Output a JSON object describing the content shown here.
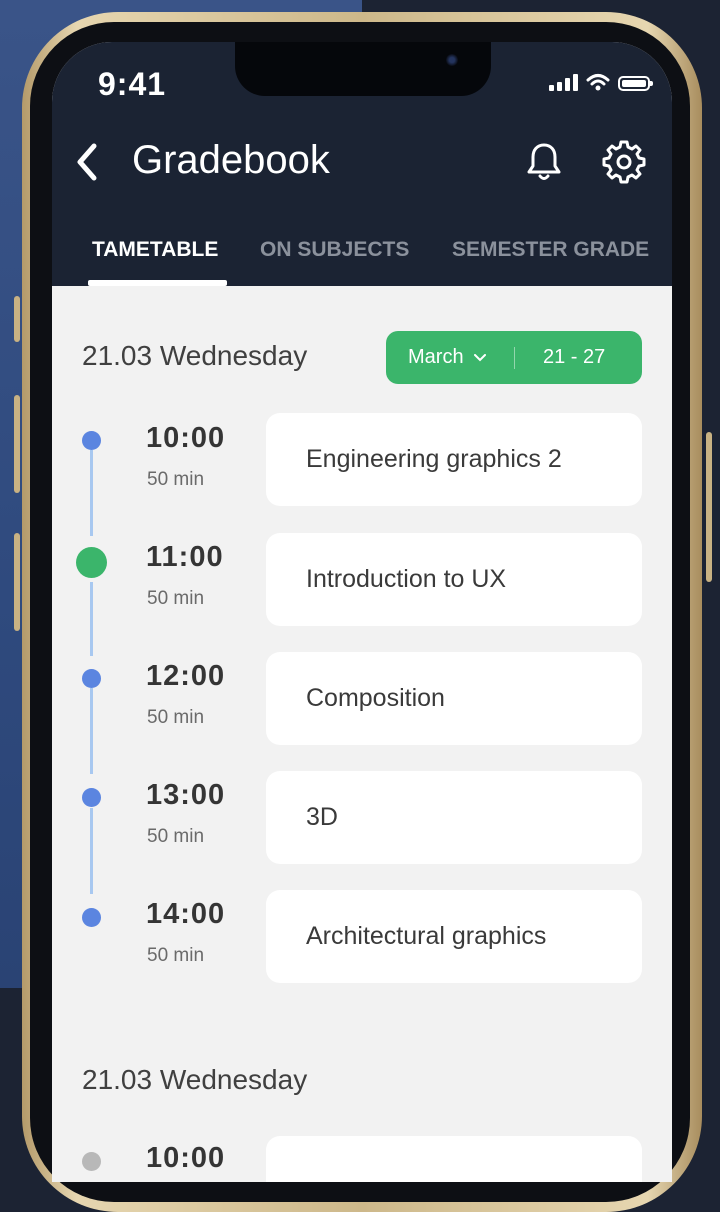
{
  "status_bar": {
    "time": "9:41"
  },
  "header": {
    "title": "Gradebook",
    "tabs": [
      {
        "label": "TAMETABLE",
        "active": true
      },
      {
        "label": "ON SUBJECTS",
        "active": false
      },
      {
        "label": "SEMESTER GRADE",
        "active": false
      }
    ]
  },
  "schedule": {
    "day_heading": "21.03 Wednesday",
    "picker": {
      "month": "March",
      "range": "21 - 27"
    },
    "lessons": [
      {
        "time": "10:00",
        "duration": "50 min",
        "subject": "Engineering graphics 2",
        "state": "upcoming"
      },
      {
        "time": "11:00",
        "duration": "50 min",
        "subject": "Introduction to UX",
        "state": "current"
      },
      {
        "time": "12:00",
        "duration": "50 min",
        "subject": "Composition",
        "state": "upcoming"
      },
      {
        "time": "13:00",
        "duration": "50 min",
        "subject": "3D",
        "state": "upcoming"
      },
      {
        "time": "14:00",
        "duration": "50 min",
        "subject": "Architectural graphics",
        "state": "upcoming"
      }
    ],
    "next_day_heading": "21.03 Wednesday",
    "next_day_first_time": "10:00"
  },
  "colors": {
    "header_bg": "#1b2333",
    "accent_green": "#3bb56b",
    "dot_blue": "#5b85e0",
    "timeline": "#a8c8f0",
    "screen_bg": "#f2f2f2"
  }
}
